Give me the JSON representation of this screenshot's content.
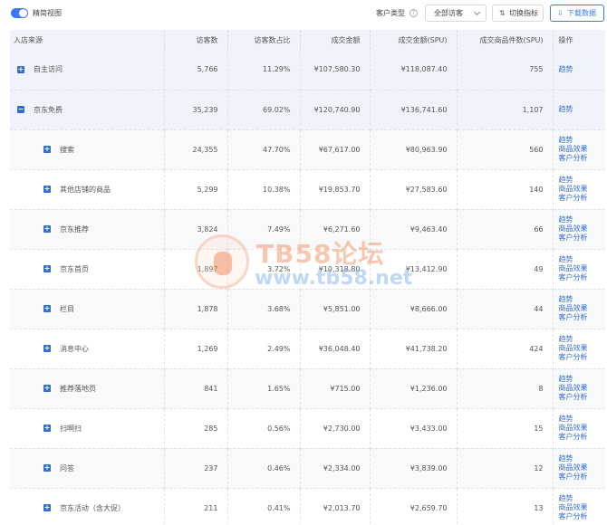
{
  "toolbar": {
    "toggle_label": "精简视图",
    "customer_type_label": "客户类型",
    "help_symbol": "?",
    "customer_type_value": "全部访客",
    "switch_metrics_label": "切换指标",
    "download_label": "下载数据",
    "accent_color": "#3a7bf5"
  },
  "table": {
    "columns": [
      "入店来源",
      "访客数",
      "访客数占比",
      "成交金额",
      "成交金额(SPU)",
      "成交商品件数(SPU)",
      "操作"
    ],
    "rows": [
      {
        "level": 1,
        "expand": "+",
        "source": "自主访问",
        "visitors": "5,766",
        "ratio": "11.29%",
        "amount": "¥107,580.30",
        "amount_spu": "¥118,087.40",
        "items_spu": "755",
        "ops": [
          "趋势"
        ]
      },
      {
        "level": 1,
        "expand": "−",
        "source": "京东免费",
        "visitors": "35,239",
        "ratio": "69.02%",
        "amount": "¥120,740.90",
        "amount_spu": "¥136,741.60",
        "items_spu": "1,107",
        "ops": [
          "趋势"
        ]
      },
      {
        "level": 2,
        "expand": "+",
        "source": "搜索",
        "visitors": "24,355",
        "ratio": "47.70%",
        "amount": "¥67,617.00",
        "amount_spu": "¥80,963.90",
        "items_spu": "560",
        "ops": [
          "趋势",
          "商品效果",
          "客户分析"
        ]
      },
      {
        "level": 2,
        "expand": "+",
        "source": "其他店铺的商品",
        "visitors": "5,299",
        "ratio": "10.38%",
        "amount": "¥19,853.70",
        "amount_spu": "¥27,583.60",
        "items_spu": "140",
        "ops": [
          "趋势",
          "商品效果",
          "客户分析"
        ]
      },
      {
        "level": 2,
        "expand": "+",
        "source": "京东推荐",
        "visitors": "3,824",
        "ratio": "7.49%",
        "amount": "¥6,271.60",
        "amount_spu": "¥9,463.40",
        "items_spu": "66",
        "ops": [
          "趋势",
          "商品效果",
          "客户分析"
        ]
      },
      {
        "level": 2,
        "expand": "+",
        "source": "京东首页",
        "visitors": "1,897",
        "ratio": "3.72%",
        "amount": "¥10,318.80",
        "amount_spu": "¥13,412.90",
        "items_spu": "49",
        "ops": [
          "趋势",
          "商品效果",
          "客户分析"
        ]
      },
      {
        "level": 2,
        "expand": "+",
        "source": "栏目",
        "visitors": "1,878",
        "ratio": "3.68%",
        "amount": "¥5,851.00",
        "amount_spu": "¥8,666.00",
        "items_spu": "44",
        "ops": [
          "趋势",
          "商品效果",
          "客户分析"
        ]
      },
      {
        "level": 2,
        "expand": "+",
        "source": "消息中心",
        "visitors": "1,269",
        "ratio": "2.49%",
        "amount": "¥36,048.40",
        "amount_spu": "¥41,738.20",
        "items_spu": "424",
        "ops": [
          "趋势",
          "商品效果",
          "客户分析"
        ]
      },
      {
        "level": 2,
        "expand": "+",
        "source": "推荐落地页",
        "visitors": "841",
        "ratio": "1.65%",
        "amount": "¥715.00",
        "amount_spu": "¥1,236.00",
        "items_spu": "8",
        "ops": [
          "趋势",
          "商品效果",
          "客户分析"
        ]
      },
      {
        "level": 2,
        "expand": "+",
        "source": "扫啊扫",
        "visitors": "285",
        "ratio": "0.56%",
        "amount": "¥2,730.00",
        "amount_spu": "¥3,433.00",
        "items_spu": "15",
        "ops": [
          "趋势",
          "商品效果",
          "客户分析"
        ]
      },
      {
        "level": 2,
        "expand": "+",
        "source": "问答",
        "visitors": "237",
        "ratio": "0.46%",
        "amount": "¥2,334.00",
        "amount_spu": "¥3,839.00",
        "items_spu": "12",
        "ops": [
          "趋势",
          "商品效果",
          "客户分析"
        ]
      },
      {
        "level": 2,
        "expand": "+",
        "source": "京东活动（含大促）",
        "visitors": "211",
        "ratio": "0.41%",
        "amount": "¥2,013.70",
        "amount_spu": "¥2,659.70",
        "items_spu": "13",
        "ops": [
          "趋势",
          "商品效果",
          "客户分析"
        ]
      }
    ]
  },
  "watermark": {
    "title": "TB58论坛",
    "url": "www.tb58.net"
  }
}
